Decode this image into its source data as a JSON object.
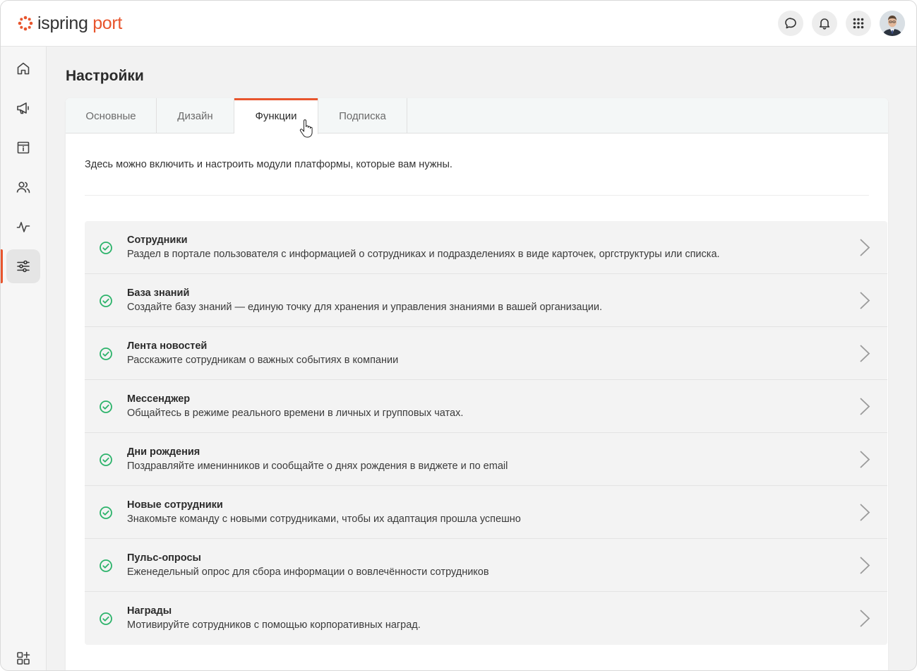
{
  "brand": {
    "name_left": "ispring",
    "name_right": "port",
    "accent": "#e8552d"
  },
  "header": {
    "icons": [
      "chat-icon",
      "bell-icon",
      "apps-grid-icon"
    ],
    "avatar": "user-avatar"
  },
  "sidebar": {
    "items": [
      {
        "name": "home-icon",
        "active": false
      },
      {
        "name": "megaphone-icon",
        "active": false
      },
      {
        "name": "info-board-icon",
        "active": false
      },
      {
        "name": "people-icon",
        "active": false
      },
      {
        "name": "pulse-icon",
        "active": false
      },
      {
        "name": "settings-sliders-icon",
        "active": true
      }
    ],
    "bottom_item": "add-widget-icon"
  },
  "page": {
    "title": "Настройки",
    "tabs": [
      "Основные",
      "Дизайн",
      "Функции",
      "Подписка"
    ],
    "active_tab": "Функции",
    "intro": "Здесь можно включить и настроить модули платформы, которые вам нужны."
  },
  "modules": [
    {
      "name": "Сотрудники",
      "desc": "Раздел в портале пользователя с информацией о сотрудниках и подразделениях в виде карточек, оргструктуры или списка.",
      "enabled": true
    },
    {
      "name": "База знаний",
      "desc": "Создайте базу знаний — единую точку для хранения и управления знаниями в вашей организации.",
      "enabled": true
    },
    {
      "name": "Лента новостей",
      "desc": "Расскажите сотрудникам о важных событиях в компании",
      "enabled": true
    },
    {
      "name": "Мессенджер",
      "desc": "Общайтесь в режиме реального времени в личных и групповых чатах.",
      "enabled": true
    },
    {
      "name": "Дни рождения",
      "desc": "Поздравляйте именинников и сообщайте о днях рождения в виджете и по email",
      "enabled": true
    },
    {
      "name": "Новые сотрудники",
      "desc": "Знакомьте команду с новыми сотрудниками, чтобы их адаптация прошла успешно",
      "enabled": true
    },
    {
      "name": "Пульс-опросы",
      "desc": "Еженедельный опрос для сбора информации о вовлечённости сотрудников",
      "enabled": true
    },
    {
      "name": "Награды",
      "desc": "Мотивируйте сотрудников с помощью корпоративных наград.",
      "enabled": true
    }
  ],
  "colors": {
    "check": "#2db36b",
    "chevron": "#9a9a9a"
  }
}
